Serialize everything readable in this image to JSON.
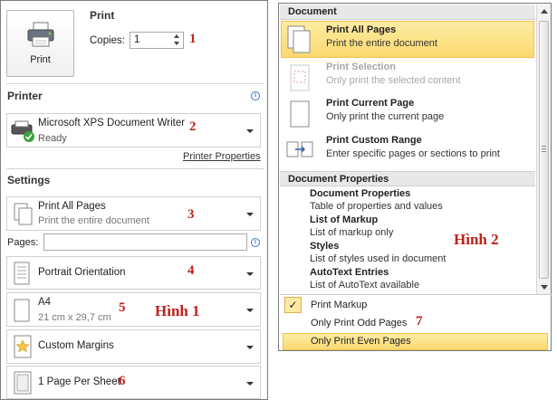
{
  "left": {
    "print_button": "Print",
    "print_heading": "Print",
    "copies_label": "Copies:",
    "copies_value": "1",
    "printer_heading": "Printer",
    "printer": {
      "name": "Microsoft XPS Document Writer",
      "status": "Ready"
    },
    "printer_properties_link": "Printer Properties",
    "settings_heading": "Settings",
    "settings": [
      {
        "title": "Print All Pages",
        "sub": "Print the entire document",
        "icon": "document-pages-icon"
      },
      {
        "title": "Portrait Orientation",
        "sub": "",
        "icon": "portrait-icon"
      },
      {
        "title": "A4",
        "sub": "21 cm x 29,7 cm",
        "icon": "paper-size-icon"
      },
      {
        "title": "Custom Margins",
        "sub": "",
        "icon": "margins-star-icon"
      },
      {
        "title": "1 Page Per Sheet",
        "sub": "",
        "icon": "pages-per-sheet-icon"
      }
    ],
    "pages_label": "Pages:",
    "pages_value": ""
  },
  "right": {
    "document_header": "Document",
    "items": [
      {
        "title": "Print All Pages",
        "desc": "Print the entire document",
        "state": "selected"
      },
      {
        "title": "Print Selection",
        "desc": "Only print the selected content",
        "state": "disabled"
      },
      {
        "title": "Print Current Page",
        "desc": "Only print the current page",
        "state": "normal"
      },
      {
        "title": "Print Custom Range",
        "desc": "Enter specific pages or sections to print",
        "state": "normal"
      }
    ],
    "properties_header": "Document Properties",
    "properties": [
      {
        "title": "Document Properties",
        "desc": "Table of properties and values"
      },
      {
        "title": "List of Markup",
        "desc": "List of markup only"
      },
      {
        "title": "Styles",
        "desc": "List of styles used in document"
      },
      {
        "title": "AutoText Entries",
        "desc": "List of AutoText available"
      }
    ],
    "print_markup": {
      "label": "Print Markup",
      "checked": true
    },
    "odd_pages": "Only Print Odd Pages",
    "even_pages": "Only Print Even Pages"
  },
  "annotations": {
    "n1": "1",
    "n2": "2",
    "n3": "3",
    "n4": "4",
    "n5": "5",
    "n6": "6",
    "n7": "7",
    "hinh1": "Hình 1",
    "hinh2": "Hình 2"
  },
  "colors": {
    "annotation": "#c0201a",
    "highlight": "#fbd970",
    "link": "#3a78c2"
  }
}
